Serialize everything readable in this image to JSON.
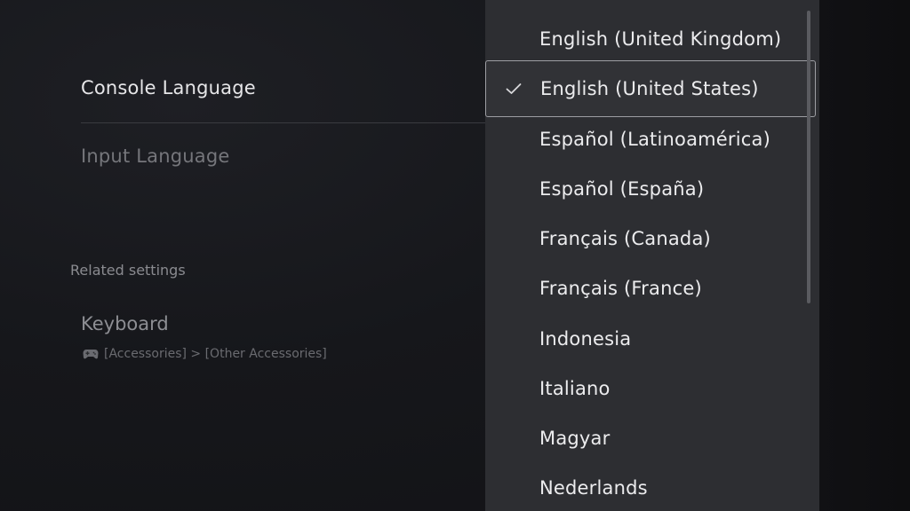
{
  "settings": {
    "console_language": "Console Language",
    "input_language": "Input Language",
    "related_header": "Related settings",
    "keyboard": {
      "title": "Keyboard",
      "path": "[Accessories] > [Other Accessories]",
      "icon": "gamepad-icon"
    }
  },
  "language_menu": {
    "selected": "English (United States)",
    "items": [
      {
        "label": "English (United Kingdom)"
      },
      {
        "label": "English (United States)"
      },
      {
        "label": "Español (Latinoamérica)"
      },
      {
        "label": "Español (España)"
      },
      {
        "label": "Français (Canada)"
      },
      {
        "label": "Français (France)"
      },
      {
        "label": "Indonesia"
      },
      {
        "label": "Italiano"
      },
      {
        "label": "Magyar"
      },
      {
        "label": "Nederlands"
      }
    ]
  },
  "colors": {
    "panel_bg": "#2d2e32",
    "selection_border": "#9d9ea3",
    "text_primary": "#ececee"
  }
}
